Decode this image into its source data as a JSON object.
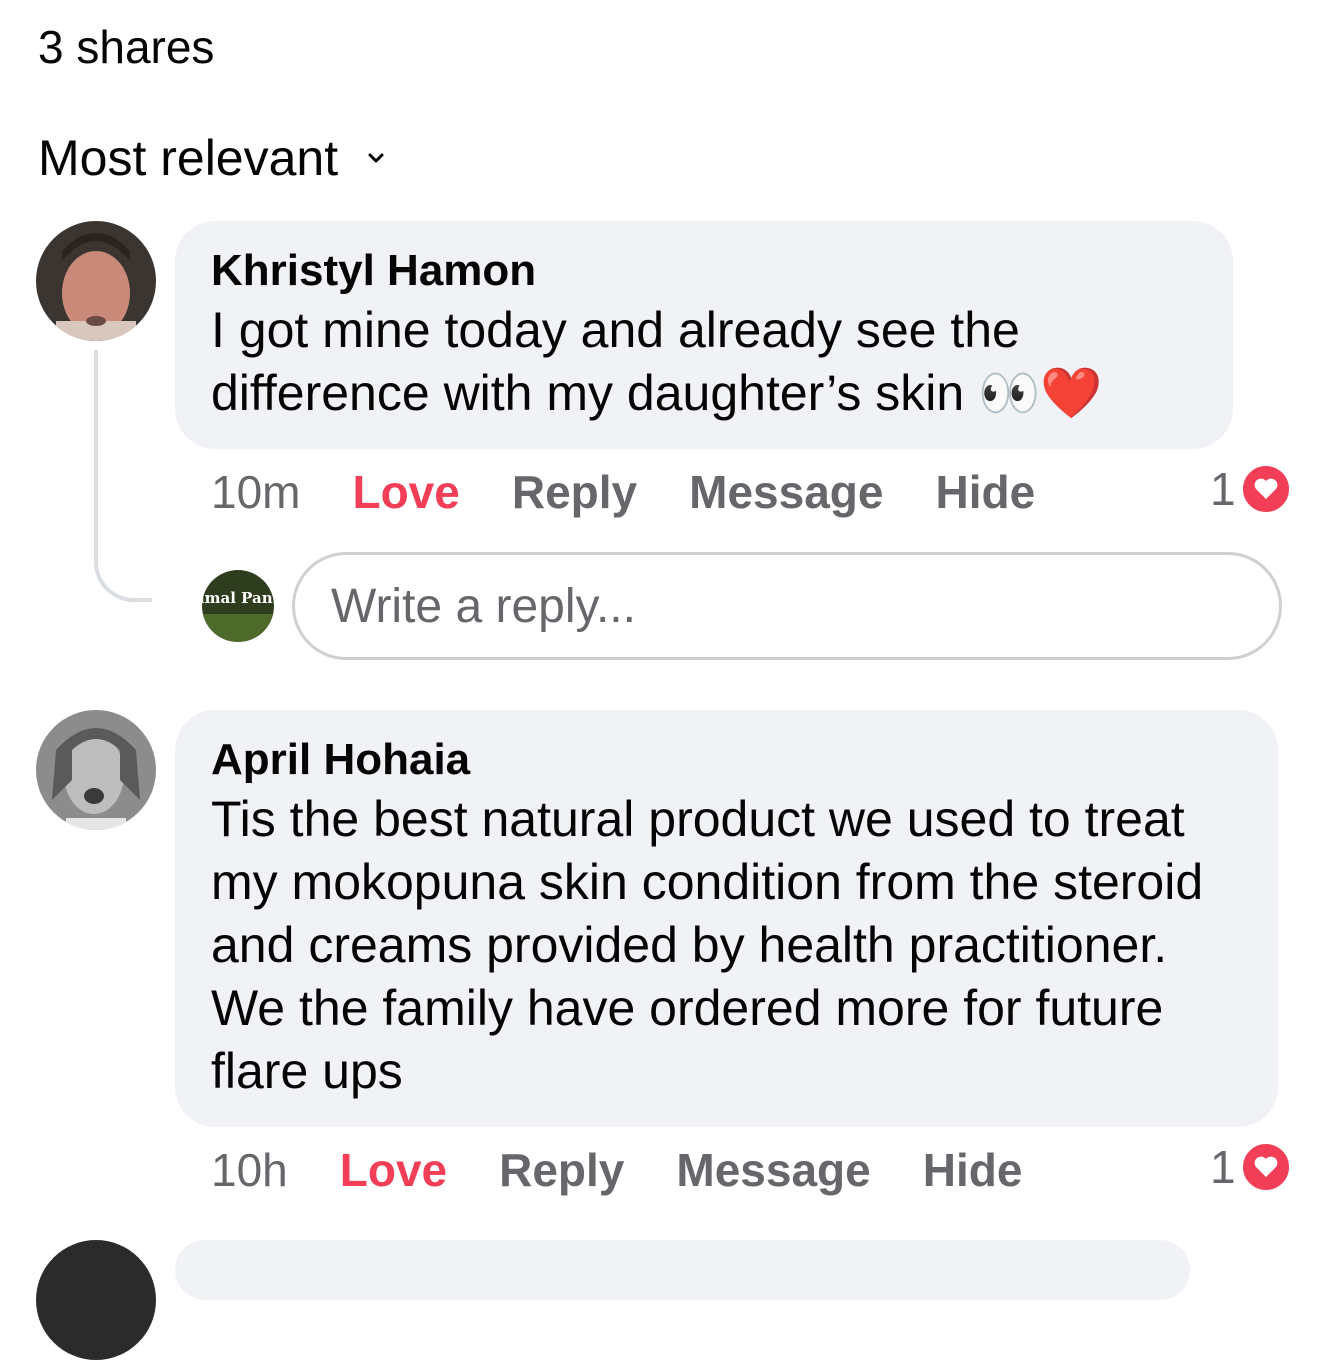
{
  "header": {
    "shares": "3 shares",
    "sort_label": "Most relevant"
  },
  "comments": [
    {
      "author": "Khristyl Hamon",
      "text": "I got mine today and already see the difference with my daughter’s skin",
      "emoji": "👀❤️",
      "time": "10m",
      "actions": {
        "love": "Love",
        "reply": "Reply",
        "message": "Message",
        "hide": "Hide"
      },
      "reaction_count": "1"
    },
    {
      "author": "April Hohaia",
      "text": "Tis the best natural product we used to treat my mokopuna skin condition from the steroid and creams provided by health practitioner. We the family have ordered more for future flare ups",
      "time": "10h",
      "actions": {
        "love": "Love",
        "reply": "Reply",
        "message": "Message",
        "hide": "Hide"
      },
      "reaction_count": "1"
    }
  ],
  "reply_box": {
    "placeholder": "Write a reply...",
    "page_avatar_text": "Primal Pantry"
  },
  "colors": {
    "love": "#f33e58",
    "bubble": "#f0f2f5",
    "muted": "#65676b"
  }
}
